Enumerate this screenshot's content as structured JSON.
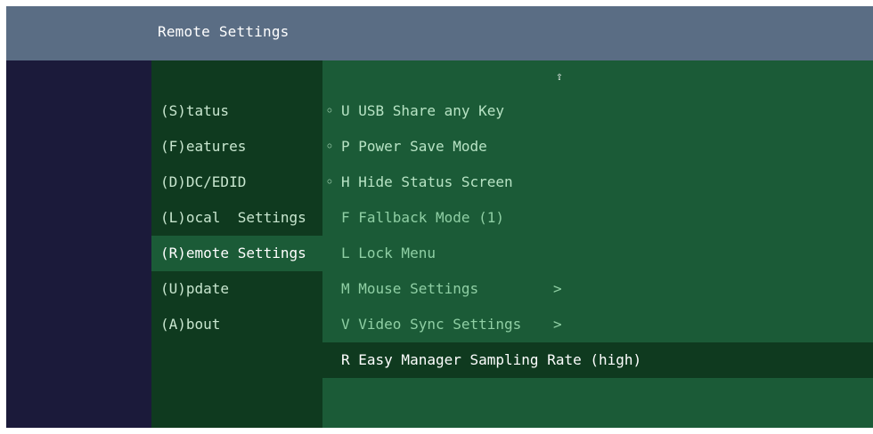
{
  "header": {
    "title": "Remote Settings"
  },
  "left_menu": {
    "items": [
      {
        "label": "(S)tatus",
        "active": false
      },
      {
        "label": "(F)eatures",
        "active": false
      },
      {
        "label": "(D)DC/EDID",
        "active": false
      },
      {
        "label": "(L)ocal  Settings",
        "active": false
      },
      {
        "label": "(R)emote Settings",
        "active": true
      },
      {
        "label": "(U)pdate",
        "active": false
      },
      {
        "label": "(A)bout",
        "active": false
      }
    ]
  },
  "right_panel": {
    "scroll_indicator": "⇧",
    "items": [
      {
        "bullet": "◦",
        "label": "U USB Share any Key"
      },
      {
        "bullet": "◦",
        "label": "P Power Save Mode"
      },
      {
        "bullet": "◦",
        "label": "H Hide Status Screen"
      },
      {
        "bullet": "",
        "label": "F Fallback Mode (1)"
      },
      {
        "bullet": "",
        "label": "L Lock Menu"
      },
      {
        "bullet": "",
        "label": "M Mouse Settings",
        "chevron": ">"
      },
      {
        "bullet": "",
        "label": "V Video Sync Settings",
        "chevron": ">"
      },
      {
        "bullet": "",
        "label": "R Easy Manager Sampling Rate (high)",
        "selected": true
      }
    ]
  },
  "colors": {
    "titlebar": "#5a6d84",
    "outer_bg": "#1b1a3a",
    "left_menu_bg": "#0f3a1f",
    "right_panel_bg": "#1b5b37",
    "selected_row_bg": "#0f3a1f",
    "text_light": "#c8e6cf"
  }
}
